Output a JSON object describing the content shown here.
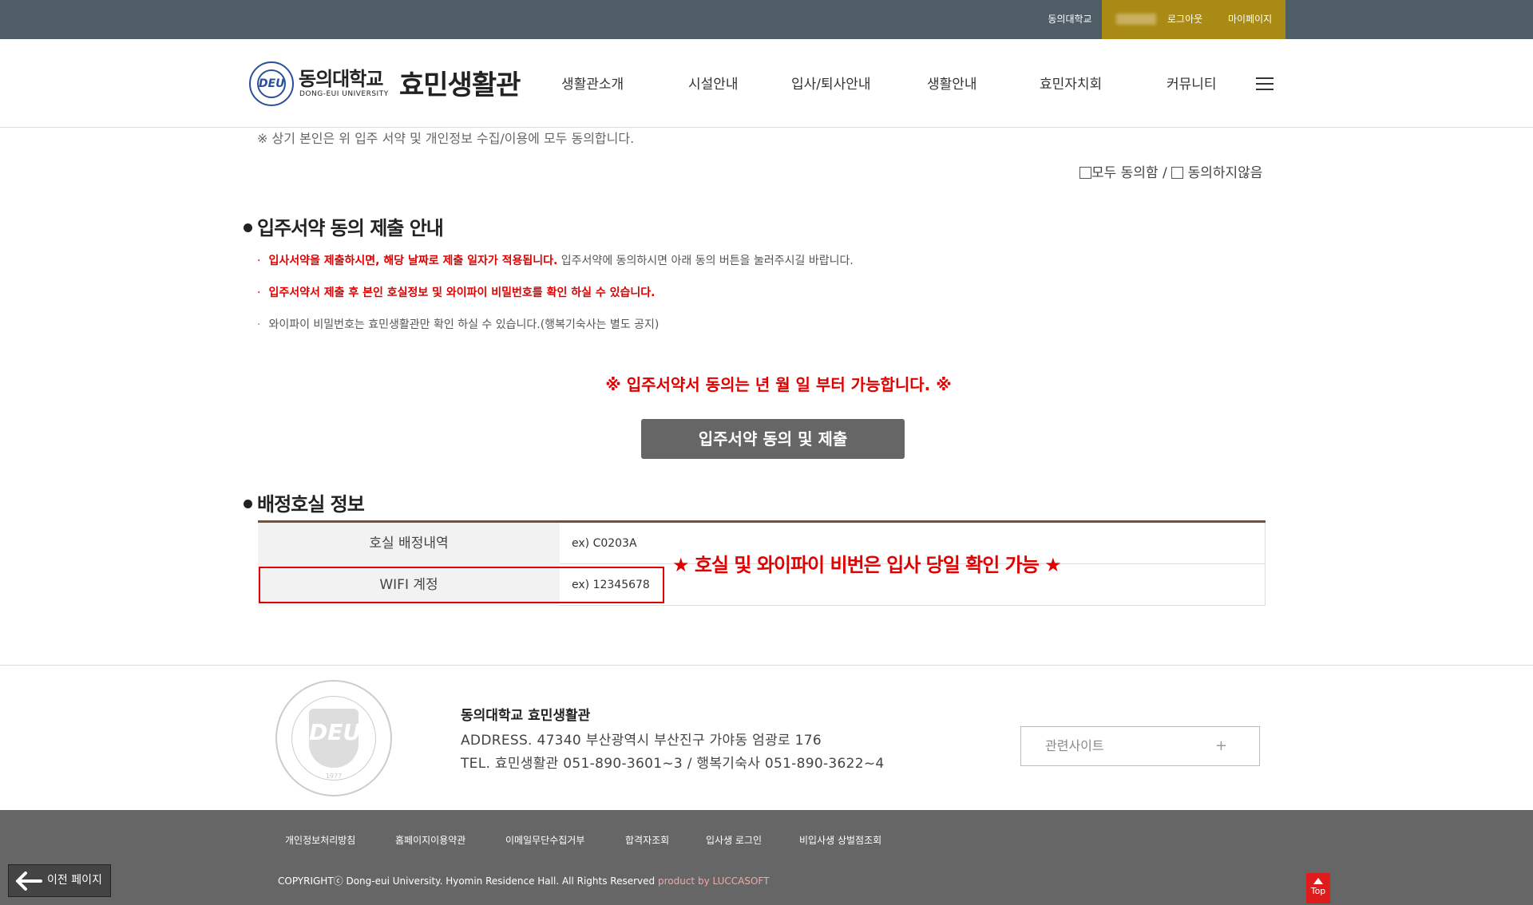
{
  "topbar": {
    "univ_link": "동의대학교",
    "logout": "로그아웃",
    "mypage": "마이페이지"
  },
  "header": {
    "logo_emblem_text": "DEU",
    "logo_univ_name": "동의대학교",
    "logo_univ_eng": "DONG-EUI UNIVERSITY",
    "logo_hall_name": "효민생활관",
    "nav": [
      "생활관소개",
      "시설안내",
      "입사/퇴사안내",
      "생활안내",
      "효민자치회",
      "커뮤니티"
    ]
  },
  "consent": {
    "notice": "※ 상기 본인은 위 입주 서약 및 개인정보 수집/이용에 모두 동의합니다.",
    "agree_all": "모두 동의함",
    "separator": "/",
    "disagree": "동의하지않음"
  },
  "submit_section": {
    "title": "입주서약 동의 제출 안내",
    "bullets": [
      {
        "red": "입사서약을 제출하시면, 해당 날짜로 제출 일자가 적용됩니다.",
        "normal": " 입주서약에 동의하시면 아래 동의 버튼을 눌러주시길 바랍니다."
      },
      {
        "red": "입주서약서 제출 후 본인 호실정보 및 와이파이 비밀번호를 확인 하실 수 있습니다.",
        "normal": ""
      },
      {
        "red": "",
        "normal": "와이파이 비밀번호는 효민생활관만 확인 하실 수 있습니다.(행복기숙사는 별도 공지)"
      }
    ],
    "bullet_mark": "·",
    "start_notice": "※ 입주서약서 동의는 년 월 일 부터 가능합니다. ※",
    "button_label": "입주서약 동의 및 제출"
  },
  "room_section": {
    "title": "배정호실 정보",
    "rows": [
      {
        "label": "호실 배정내역",
        "value": "ex) C0203A"
      },
      {
        "label": "WIFI 계정",
        "value": "ex) 12345678"
      }
    ],
    "star_note": "★ 호실 및 와이파이 비번은 입사 당일 확인 가능 ★"
  },
  "footer": {
    "seal_text": "DEU",
    "seal_year": "1977",
    "name": "동의대학교 효민생활관",
    "address": "ADDRESS. 47340 부산광역시 부산진구 가야동 엄광로 176",
    "tel": "TEL. 효민생활관 051-890-3601~3 / 행복기숙사 051-890-3622~4",
    "related_label": "관련사이트",
    "related_plus": "+",
    "links": [
      "개인정보처리방침",
      "홈페이지이용약관",
      "이메일무단수집거부",
      "합격자조회",
      "입사생 로그인",
      "비입사생 상벌점조회"
    ],
    "copyright": "COPYRIGHTⓒ Dong-eui University. Hyomin Residence Hall. All Rights Reserved ",
    "product_by": "product by LUCCASOFT",
    "top_label": "Top"
  },
  "back_button": {
    "label": "이전 페이지"
  },
  "colors": {
    "topbar": "#4f5d66",
    "gold": "#a88a14",
    "red": "#e00000",
    "footer": "#666666",
    "table_top": "#6b5444"
  }
}
